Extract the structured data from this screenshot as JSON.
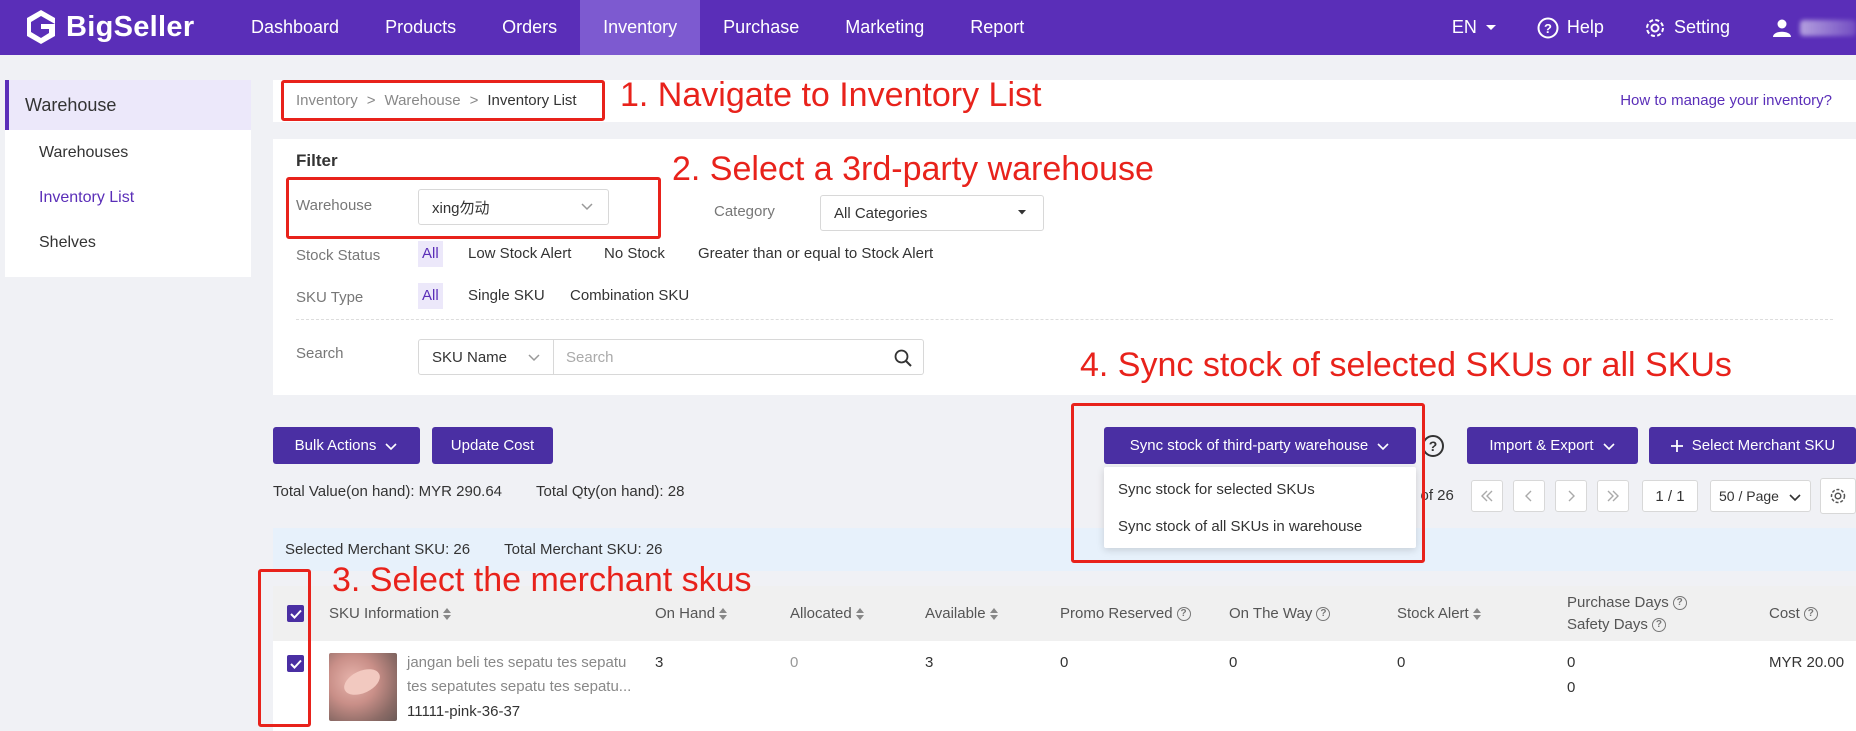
{
  "topnav": {
    "logo_text": "BigSeller",
    "items": [
      "Dashboard",
      "Products",
      "Orders",
      "Inventory",
      "Purchase",
      "Marketing",
      "Report"
    ],
    "active_index": 3,
    "language": "EN",
    "help": "Help",
    "setting": "Setting"
  },
  "sidebar": {
    "section": "Warehouse",
    "items": [
      "Warehouses",
      "Inventory List",
      "Shelves"
    ],
    "active_index": 1
  },
  "breadcrumb": {
    "items": [
      "Inventory",
      "Warehouse",
      "Inventory List"
    ],
    "separator": ">",
    "help_link": "How to manage your inventory?"
  },
  "filter": {
    "title": "Filter",
    "warehouse_label": "Warehouse",
    "warehouse_value": "xing勿动",
    "category_label": "Category",
    "category_value": "All Categories",
    "stock_status_label": "Stock Status",
    "stock_status_options": [
      "All",
      "Low Stock Alert",
      "No Stock",
      "Greater than or equal to Stock Alert"
    ],
    "sku_type_label": "SKU Type",
    "sku_type_options": [
      "All",
      "Single SKU",
      "Combination SKU"
    ],
    "search_label": "Search",
    "search_field": "SKU Name",
    "search_placeholder": "Search"
  },
  "actions": {
    "bulk_actions": "Bulk Actions",
    "update_cost": "Update Cost",
    "sync_stock": "Sync stock of third-party warehouse",
    "sync_menu": [
      "Sync stock for selected SKUs",
      "Sync stock of all SKUs in warehouse"
    ],
    "import_export": "Import & Export",
    "select_merchant_sku": "Select Merchant SKU"
  },
  "totals": {
    "value": "Total Value(on hand): MYR 290.64",
    "qty": "Total Qty(on hand): 28"
  },
  "pagination": {
    "range_text": "5 of 26",
    "page": "1 / 1",
    "per_page": "50 / Page"
  },
  "selection": {
    "selected": "Selected Merchant SKU: 26",
    "total": "Total Merchant SKU: 26"
  },
  "table": {
    "headers": {
      "sku_info": "SKU Information",
      "on_hand": "On Hand",
      "allocated": "Allocated",
      "available": "Available",
      "promo_reserved": "Promo Reserved",
      "on_the_way": "On The Way",
      "stock_alert": "Stock Alert",
      "purchase_days": "Purchase Days",
      "safety_days": "Safety Days",
      "cost": "Cost"
    },
    "rows": [
      {
        "name_line1": "jangan beli tes sepatu tes sepatu",
        "name_line2": "tes sepatutes sepatu tes sepatu...",
        "sku": "11111-pink-36-37",
        "on_hand": "3",
        "allocated": "0",
        "available": "3",
        "promo_reserved": "0",
        "on_the_way": "0",
        "stock_alert": "0",
        "purchase_days": "0",
        "safety_days": "0",
        "cost": "MYR 20.00"
      }
    ]
  },
  "annotations": {
    "step1": "1. Navigate to Inventory List",
    "step2": "2. Select a 3rd-party warehouse",
    "step3": "3. Select the merchant skus",
    "step4": "4. Sync stock of selected SKUs or all SKUs"
  },
  "colors": {
    "nav_bg": "#5a2eb8",
    "primary_button": "#4a2fa3",
    "annotation_red": "#e8221b",
    "selection_bar": "#e7f1fb"
  }
}
